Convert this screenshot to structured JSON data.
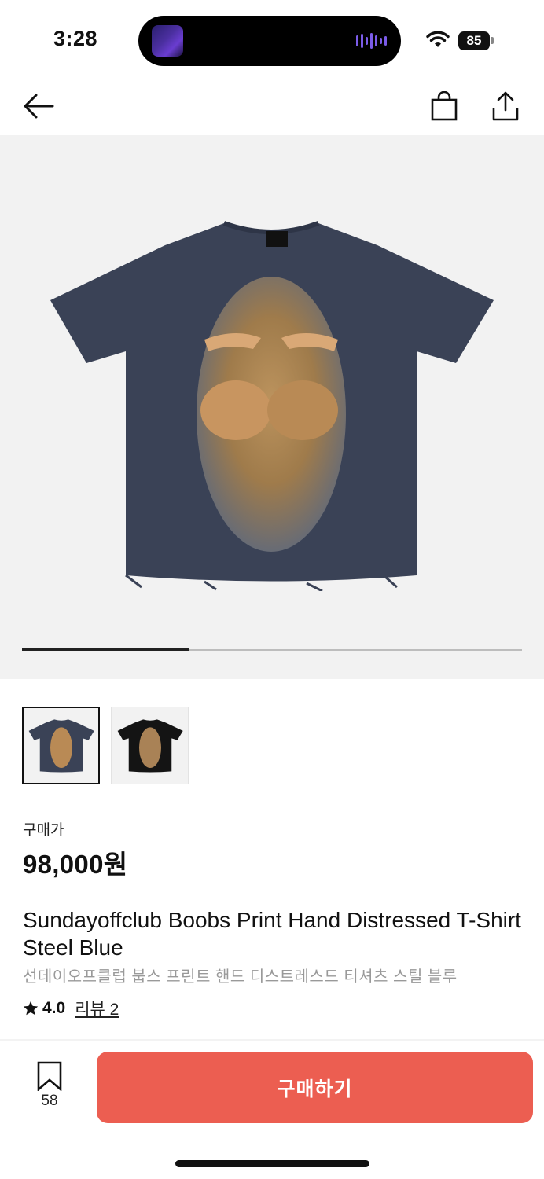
{
  "status_bar": {
    "time": "3:28",
    "battery": "85"
  },
  "nav": {
    "icons": [
      "back-arrow-icon",
      "shopping-bag-icon",
      "share-icon"
    ]
  },
  "gallery": {
    "current_index": 1,
    "total_images": 3,
    "progress_fraction": 0.333,
    "thumbnails": [
      {
        "color": "navy",
        "selected": true
      },
      {
        "color": "black",
        "selected": false
      }
    ]
  },
  "product": {
    "price_label": "구매가",
    "price": "98,000원",
    "name": "Sundayoffclub Boobs Print Hand Distressed T-Shirt Steel Blue",
    "name_kr": "선데이오프클럽 붑스 프린트 핸드 디스트레스드 티셔츠 스틸 블루",
    "rating": "4.0",
    "review_link": "리뷰 2"
  },
  "actions": {
    "bookmark_count": "58",
    "buy_label": "구매하기"
  },
  "colors": {
    "accent": "#ec5e51",
    "shirt_navy": "#3a4256",
    "shirt_black": "#141414"
  }
}
